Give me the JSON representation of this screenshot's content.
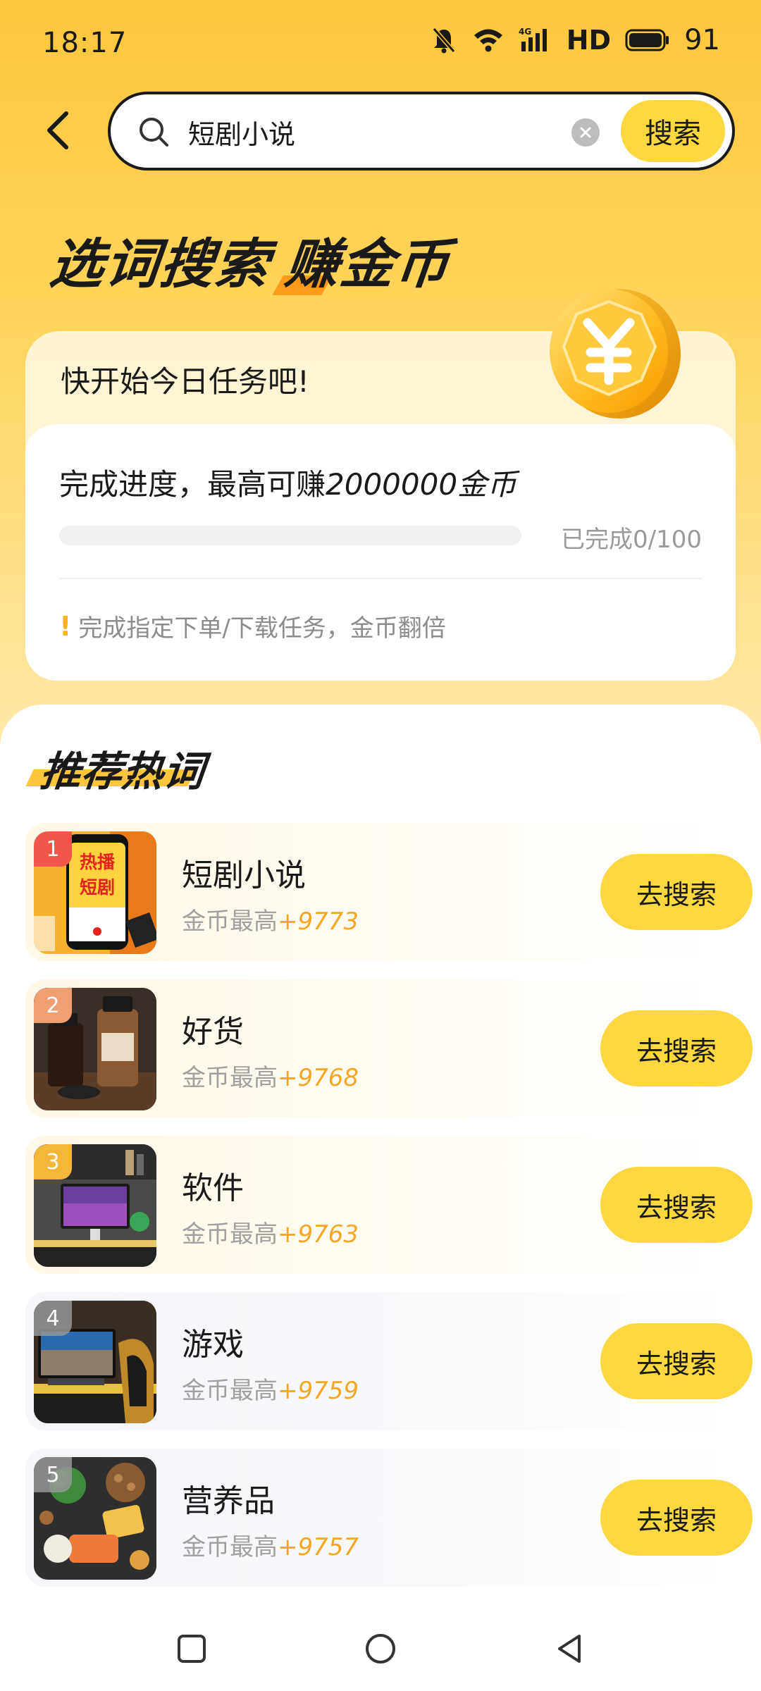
{
  "status_bar": {
    "time": "18:17",
    "network": "4G",
    "hd": "HD",
    "battery": "91"
  },
  "search": {
    "value": "短剧小说",
    "button_label": "搜索"
  },
  "banner": {
    "title_part1": "选词搜索",
    "title_part2": "赚金币"
  },
  "task": {
    "header": "快开始今日任务吧!",
    "progress_text": "完成进度，最高可赚",
    "reward_text": "2000000金币",
    "progress_label": "已完成0/100",
    "progress_value": 0,
    "tip": "完成指定下单/下载任务，金币翻倍"
  },
  "recommend": {
    "title": "推荐热词",
    "reward_prefix": "金币最高",
    "button_label": "去搜索",
    "items": [
      {
        "rank": "1",
        "name": "短剧小说",
        "reward": "+9773"
      },
      {
        "rank": "2",
        "name": "好货",
        "reward": "+9768"
      },
      {
        "rank": "3",
        "name": "软件",
        "reward": "+9763"
      },
      {
        "rank": "4",
        "name": "游戏",
        "reward": "+9759"
      },
      {
        "rank": "5",
        "name": "营养品",
        "reward": "+9757"
      }
    ]
  },
  "thumb1": {
    "line1": "热播",
    "line2": "短剧"
  },
  "colors": {
    "accent": "#FFD740",
    "reward": "#F5A623",
    "background": "#FFC73D"
  }
}
